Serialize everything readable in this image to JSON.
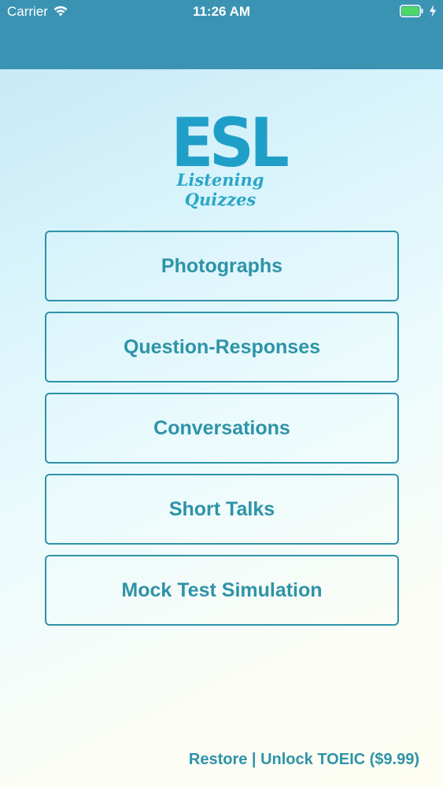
{
  "status_bar": {
    "carrier": "Carrier",
    "time": "11:26 AM"
  },
  "logo": {
    "title": "ESL",
    "subtitle": "Listening Quizzes"
  },
  "menu": {
    "items": [
      {
        "label": "Photographs"
      },
      {
        "label": "Question-Responses"
      },
      {
        "label": "Conversations"
      },
      {
        "label": "Short Talks"
      },
      {
        "label": "Mock Test Simulation"
      }
    ]
  },
  "footer": {
    "restore": "Restore",
    "separator": " | ",
    "unlock": "Unlock TOEIC ($9.99)"
  },
  "colors": {
    "header": "#3b93b4",
    "accent": "#2e93a8",
    "logo": "#1f9fc8"
  },
  "icons": [
    "wifi-icon",
    "battery-icon",
    "charging-bolt-icon"
  ]
}
